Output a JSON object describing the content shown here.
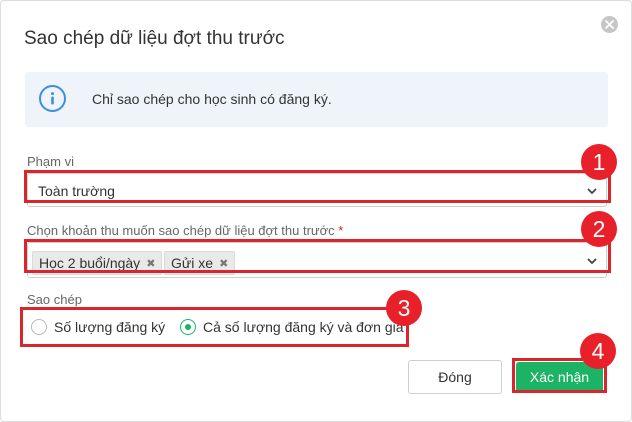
{
  "dialog": {
    "title": "Sao chép dữ liệu đợt thu trước",
    "close_icon": "close-icon"
  },
  "info": {
    "icon": "info-icon",
    "text": "Chỉ sao chép cho học sinh có đăng ký."
  },
  "scope": {
    "label": "Phạm vi",
    "value": "Toàn trường"
  },
  "fees": {
    "label": "Chọn khoản thu muốn sao chép dữ liệu đợt thu trước",
    "required_mark": "*",
    "selected": [
      "Học 2 buổi/ngày",
      "Gửi xe"
    ],
    "remove_symbol": "✖"
  },
  "copy_mode": {
    "label": "Sao chép",
    "options": [
      {
        "label": "Số lượng đăng ký",
        "checked": false
      },
      {
        "label": "Cả số lượng đăng ký và đơn giá",
        "checked": true
      }
    ]
  },
  "badges": [
    "1",
    "2",
    "3",
    "4"
  ],
  "footer": {
    "close_label": "Đóng",
    "confirm_label": "Xác nhận"
  },
  "colors": {
    "accent_green": "#1cb464",
    "highlight_red": "#d9262c",
    "info_blue": "#3b8fe0"
  }
}
